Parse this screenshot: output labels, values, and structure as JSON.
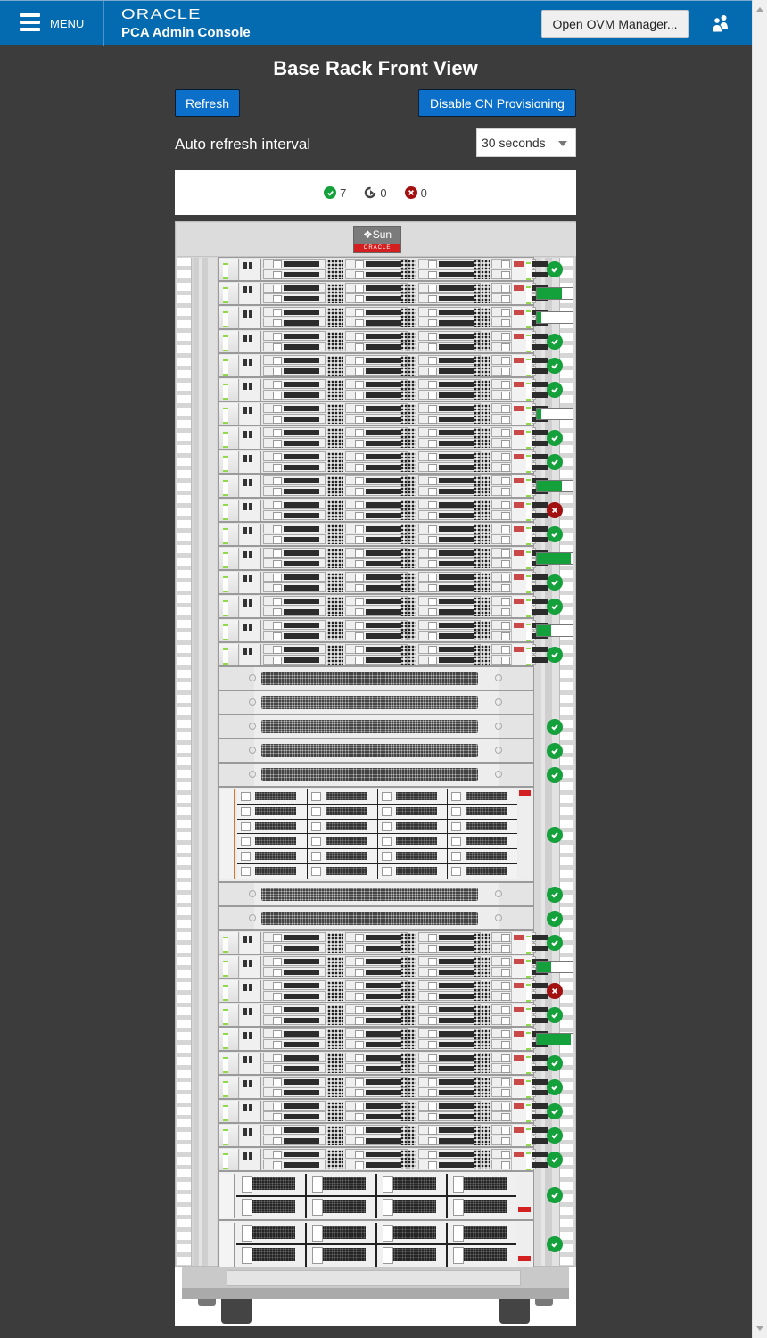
{
  "header": {
    "menu_label": "MENU",
    "brand_top": "ORACLE",
    "brand_sub": "PCA Admin Console",
    "open_ovm_label": "Open OVM Manager...",
    "user_icon": "users-icon"
  },
  "page": {
    "title": "Base Rack Front View",
    "refresh_label": "Refresh",
    "disable_cn_label": "Disable CN Provisioning",
    "auto_refresh_label": "Auto refresh interval",
    "auto_refresh_value": "30 seconds"
  },
  "summary": {
    "ok_count": "7",
    "pending_count": "0",
    "error_count": "0"
  },
  "rack": {
    "logo_top": "Sun",
    "logo_bottom": "ORACLE",
    "colors": {
      "ok": "#14a03a",
      "error": "#a31010",
      "progress": "#14a03a"
    },
    "units": [
      {
        "type": "server",
        "status": "ok"
      },
      {
        "type": "server",
        "status": "progress",
        "progress": 0.7
      },
      {
        "type": "server",
        "status": "progress",
        "progress": 0.12
      },
      {
        "type": "server",
        "status": "ok"
      },
      {
        "type": "server",
        "status": "ok"
      },
      {
        "type": "server",
        "status": "ok"
      },
      {
        "type": "server",
        "status": "progress",
        "progress": 0.12
      },
      {
        "type": "server",
        "status": "ok"
      },
      {
        "type": "server",
        "status": "ok"
      },
      {
        "type": "server",
        "status": "progress",
        "progress": 0.7
      },
      {
        "type": "server",
        "status": "error"
      },
      {
        "type": "server",
        "status": "ok"
      },
      {
        "type": "server",
        "status": "progress",
        "progress": 0.95
      },
      {
        "type": "server",
        "status": "ok"
      },
      {
        "type": "server",
        "status": "ok"
      },
      {
        "type": "server",
        "status": "progress",
        "progress": 0.4
      },
      {
        "type": "server",
        "status": "ok"
      },
      {
        "type": "blank",
        "status": "none"
      },
      {
        "type": "blank",
        "status": "none"
      },
      {
        "type": "blank",
        "status": "ok"
      },
      {
        "type": "blank",
        "status": "ok"
      },
      {
        "type": "blank",
        "status": "ok"
      },
      {
        "type": "storage",
        "status": "ok"
      },
      {
        "type": "blank",
        "status": "ok"
      },
      {
        "type": "blank",
        "status": "ok"
      },
      {
        "type": "server",
        "status": "ok"
      },
      {
        "type": "server",
        "status": "progress",
        "progress": 0.4
      },
      {
        "type": "server",
        "status": "error"
      },
      {
        "type": "server",
        "status": "ok"
      },
      {
        "type": "server",
        "status": "progress",
        "progress": 0.95
      },
      {
        "type": "server",
        "status": "ok"
      },
      {
        "type": "server",
        "status": "ok"
      },
      {
        "type": "server",
        "status": "ok"
      },
      {
        "type": "server",
        "status": "ok"
      },
      {
        "type": "server",
        "status": "ok"
      },
      {
        "type": "node",
        "status": "ok"
      },
      {
        "type": "node",
        "status": "ok"
      }
    ]
  }
}
